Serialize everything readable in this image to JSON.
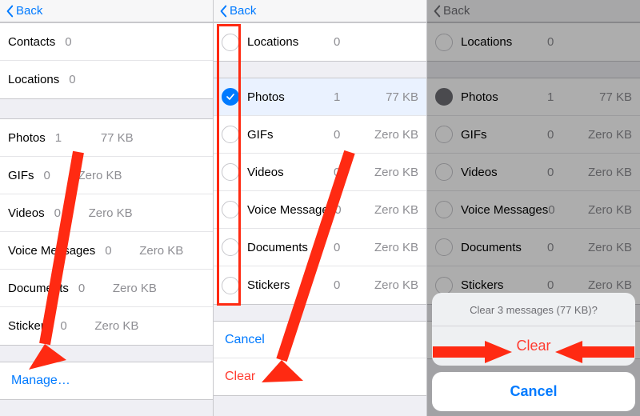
{
  "nav": {
    "back": "Back"
  },
  "panel1": {
    "section1": [
      {
        "label": "Contacts",
        "count": "0",
        "size": ""
      },
      {
        "label": "Locations",
        "count": "0",
        "size": ""
      }
    ],
    "section2": [
      {
        "label": "Photos",
        "count": "1",
        "size": "77 KB"
      },
      {
        "label": "GIFs",
        "count": "0",
        "size": "Zero KB"
      },
      {
        "label": "Videos",
        "count": "0",
        "size": "Zero KB"
      },
      {
        "label": "Voice Messages",
        "count": "0",
        "size": "Zero KB"
      },
      {
        "label": "Documents",
        "count": "0",
        "size": "Zero KB"
      },
      {
        "label": "Stickers",
        "count": "0",
        "size": "Zero KB"
      }
    ],
    "manage": "Manage…"
  },
  "panel2": {
    "rows": [
      {
        "label": "Locations",
        "count": "0",
        "size": "",
        "checked": false,
        "selected": false
      },
      {
        "label": "Photos",
        "count": "1",
        "size": "77 KB",
        "checked": true,
        "selected": true
      },
      {
        "label": "GIFs",
        "count": "0",
        "size": "Zero KB",
        "checked": false,
        "selected": false
      },
      {
        "label": "Videos",
        "count": "0",
        "size": "Zero KB",
        "checked": false,
        "selected": false
      },
      {
        "label": "Voice Messages",
        "count": "0",
        "size": "Zero KB",
        "checked": false,
        "selected": false
      },
      {
        "label": "Documents",
        "count": "0",
        "size": "Zero KB",
        "checked": false,
        "selected": false
      },
      {
        "label": "Stickers",
        "count": "0",
        "size": "Zero KB",
        "checked": false,
        "selected": false
      }
    ],
    "cancel": "Cancel",
    "clear": "Clear"
  },
  "panel3": {
    "rows": [
      {
        "label": "Locations",
        "count": "0",
        "size": ""
      },
      {
        "label": "Photos",
        "count": "1",
        "size": "77 KB",
        "checked": true
      },
      {
        "label": "GIFs",
        "count": "0",
        "size": "Zero KB"
      },
      {
        "label": "Videos",
        "count": "0",
        "size": "Zero KB"
      },
      {
        "label": "Voice Messages",
        "count": "0",
        "size": "Zero KB"
      },
      {
        "label": "Documents",
        "count": "0",
        "size": "Zero KB"
      },
      {
        "label": "Stickers",
        "count": "0",
        "size": "Zero KB"
      }
    ],
    "clear_under": "Clear",
    "sheet_title": "Clear 3 messages (77 KB)?",
    "sheet_clear": "Clear",
    "sheet_cancel": "Cancel"
  }
}
